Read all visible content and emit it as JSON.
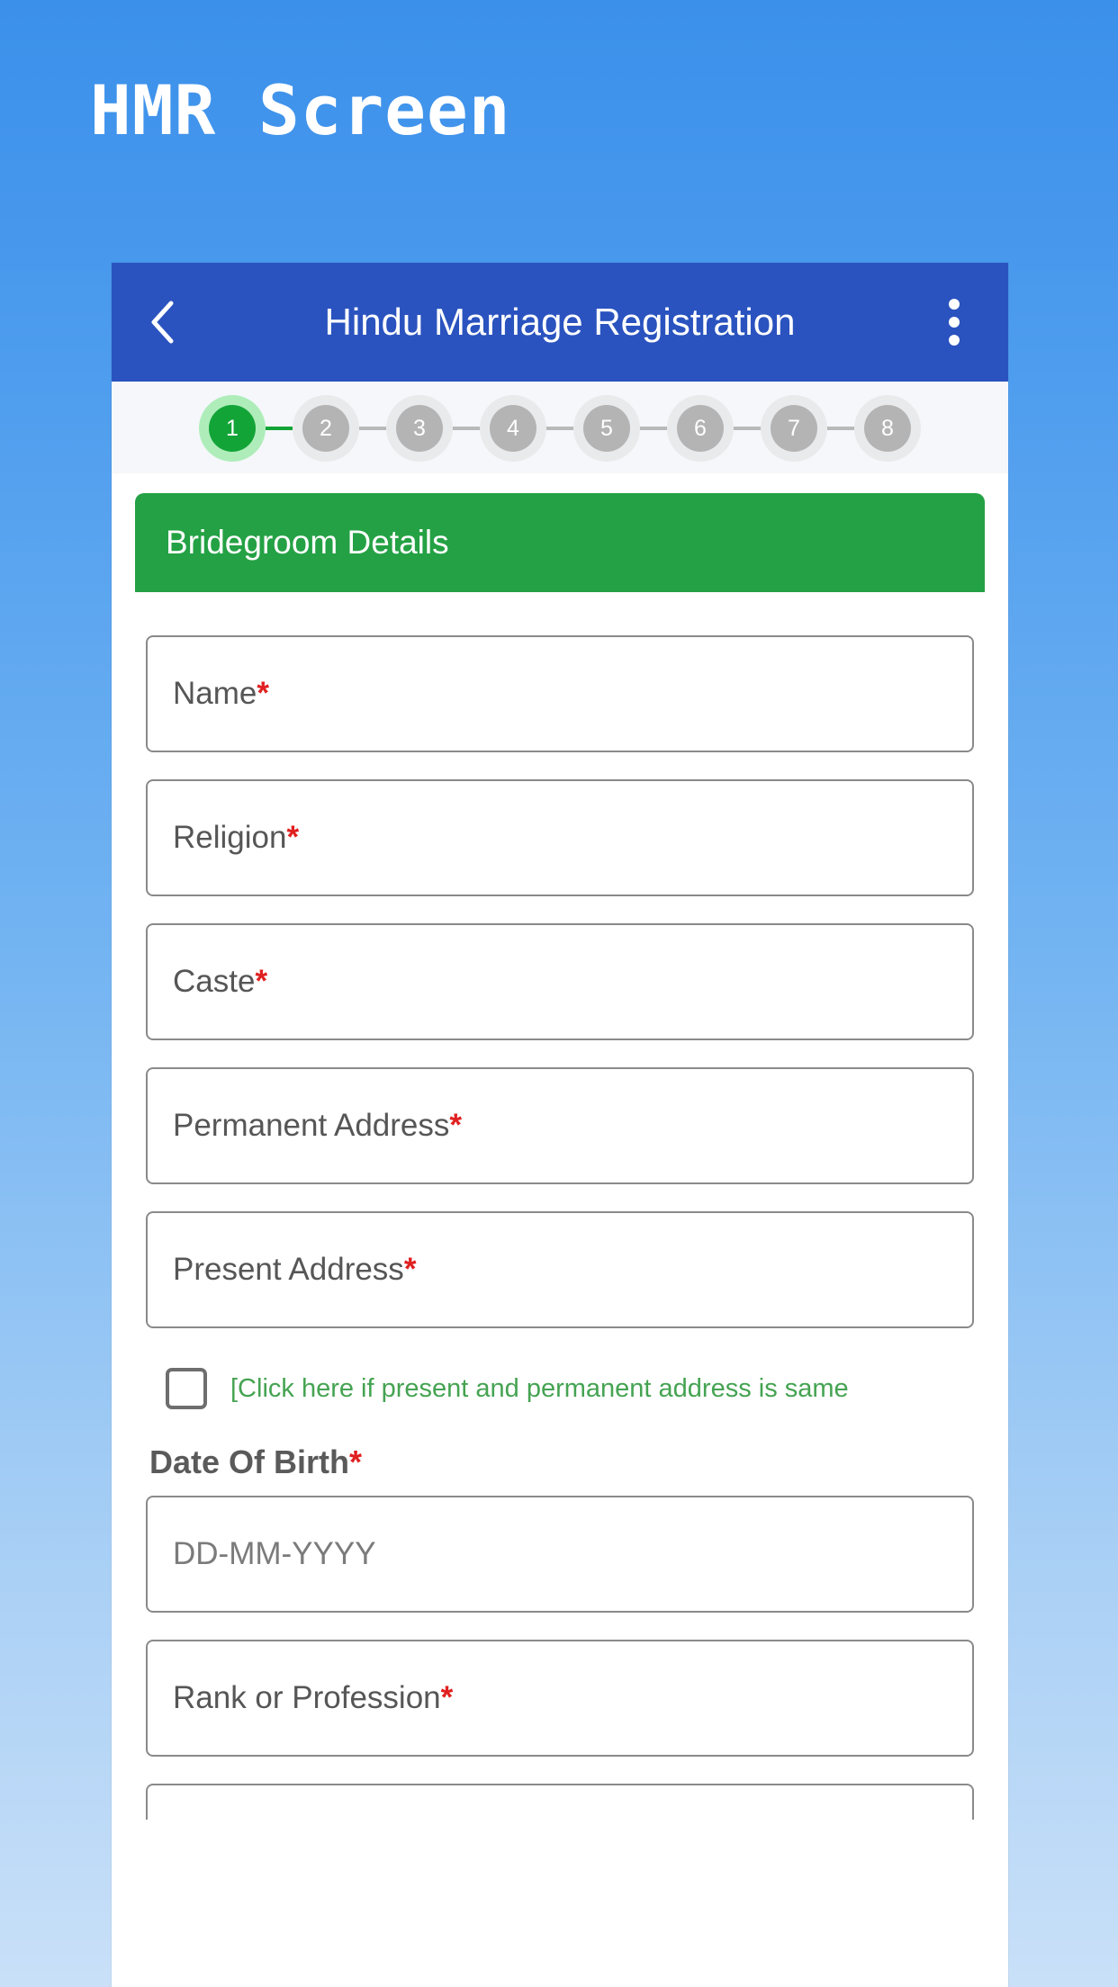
{
  "page": {
    "title": "HMR Screen"
  },
  "appbar": {
    "back_icon": "chevron-left-icon",
    "title": "Hindu Marriage Registration",
    "menu_icon": "kebab-menu-icon"
  },
  "stepper": {
    "steps": [
      {
        "label": "1",
        "state": "active"
      },
      {
        "label": "2",
        "state": "inactive"
      },
      {
        "label": "3",
        "state": "inactive"
      },
      {
        "label": "4",
        "state": "inactive"
      },
      {
        "label": "5",
        "state": "inactive"
      },
      {
        "label": "6",
        "state": "inactive"
      },
      {
        "label": "7",
        "state": "inactive"
      },
      {
        "label": "8",
        "state": "inactive"
      }
    ]
  },
  "section": {
    "heading": "Bridegroom Details",
    "accent_color": "#24a144"
  },
  "form": {
    "required_marker": "*",
    "fields": [
      {
        "label": "Name",
        "required": true,
        "value": ""
      },
      {
        "label": "Religion",
        "required": true,
        "value": ""
      },
      {
        "label": "Caste",
        "required": true,
        "value": ""
      },
      {
        "label": "Permanent Address",
        "required": true,
        "value": ""
      },
      {
        "label": "Present Address",
        "required": true,
        "value": ""
      }
    ],
    "same_address_checkbox": {
      "label": "[Click here if present and permanent address is same",
      "checked": false,
      "color": "#45a352"
    },
    "dob": {
      "label": "Date Of Birth",
      "required": true,
      "placeholder": "DD-MM-YYYY",
      "value": ""
    },
    "profession": {
      "label": "Rank or Profession",
      "required": true,
      "value": ""
    }
  },
  "colors": {
    "background_top": "#3b90ea",
    "background_bottom": "#c9e0f8",
    "appbar": "#2a53bf",
    "active_step": "#13a438",
    "active_step_halo": "#aeedba",
    "inactive_step": "#b4b4b4",
    "required_red": "#e02020"
  }
}
